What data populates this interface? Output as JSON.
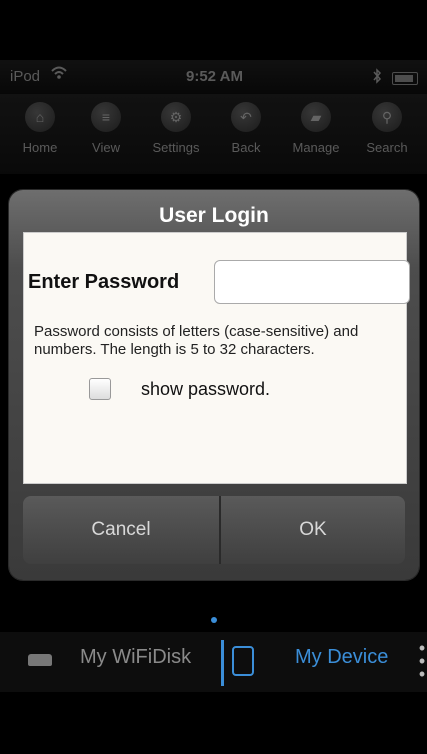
{
  "status_bar": {
    "carrier": "iPod",
    "time": "9:52 AM"
  },
  "toolbar": {
    "items": [
      {
        "label": "Home",
        "icon": "home-icon",
        "glyph": "⌂"
      },
      {
        "label": "View",
        "icon": "list-icon",
        "glyph": "≡"
      },
      {
        "label": "Settings",
        "icon": "gear-icon",
        "glyph": "⚙"
      },
      {
        "label": "Back",
        "icon": "back-icon",
        "glyph": "↶"
      },
      {
        "label": "Manage",
        "icon": "folder-icon",
        "glyph": "▰"
      },
      {
        "label": "Search",
        "icon": "search-icon",
        "glyph": "⚲"
      }
    ]
  },
  "dialog": {
    "title": "User Login",
    "password_label": "Enter Password",
    "password_value": "",
    "hint": "Password consists of letters (case-sensitive) and numbers. The length is 5 to 32 characters.",
    "show_password_label": "show password.",
    "show_password_checked": false,
    "cancel_label": "Cancel",
    "ok_label": "OK"
  },
  "bottom_tabs": {
    "wifi_disk": "My WiFiDisk",
    "my_device": "My Device",
    "active_tab": "My Device"
  },
  "colors": {
    "accent": "#3b8ed8",
    "dialog_body": "#fbf9f4"
  }
}
